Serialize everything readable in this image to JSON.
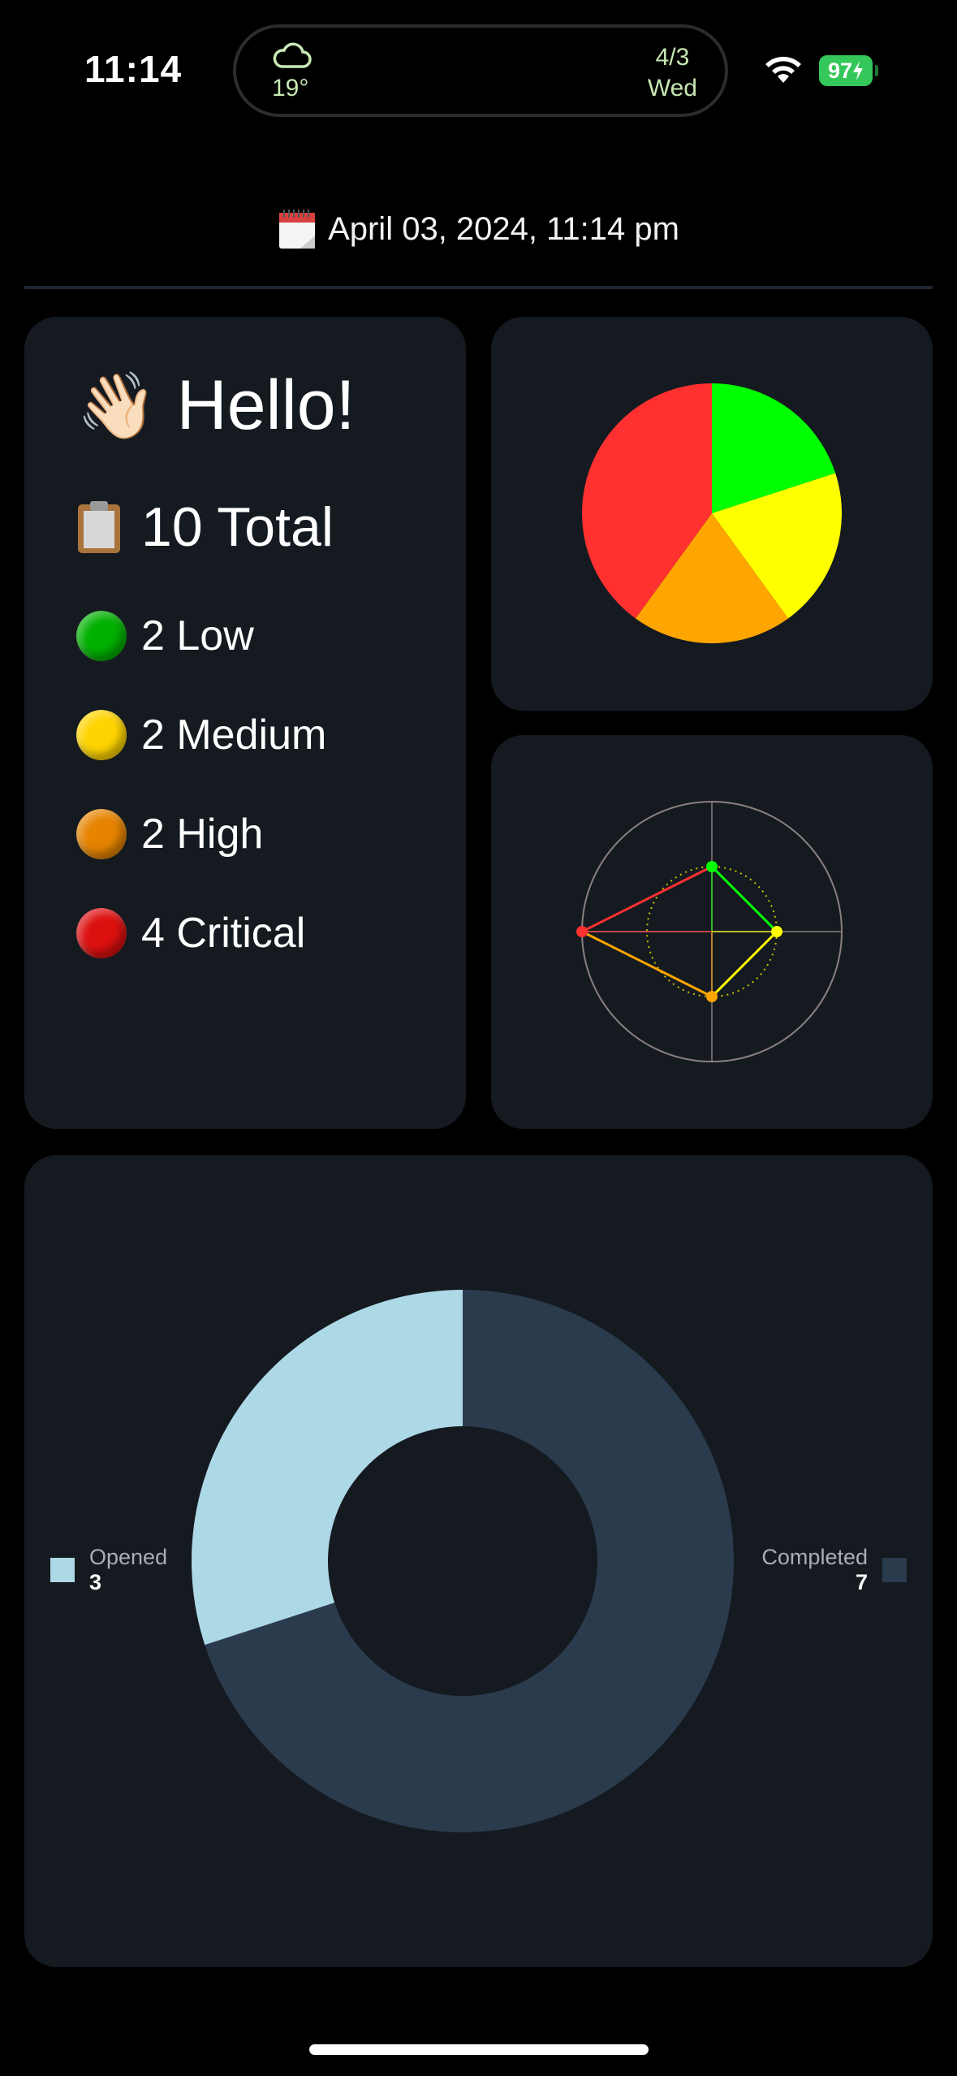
{
  "status_bar": {
    "time": "11:14",
    "weather_temp": "19°",
    "island_date": "4/3",
    "island_day": "Wed",
    "weather_icon": "cloud-icon",
    "battery": "97"
  },
  "header": {
    "date_text": "April 03, 2024, 11:14 pm",
    "icon": "calendar-icon"
  },
  "summary": {
    "greeting": "Hello!",
    "greeting_icon": "waving-hand-icon",
    "total_text": "10 Total",
    "total_icon": "clipboard-icon",
    "items": [
      {
        "label": "2 Low",
        "count": 2,
        "color": "#00c000"
      },
      {
        "label": "2 Medium",
        "count": 2,
        "color": "#ffd800"
      },
      {
        "label": "2 High",
        "count": 2,
        "color": "#f08800"
      },
      {
        "label": "4 Critical",
        "count": 4,
        "color": "#e01010"
      }
    ]
  },
  "chart_data": [
    {
      "type": "pie",
      "categories": [
        "Low",
        "Medium",
        "High",
        "Critical"
      ],
      "values": [
        2,
        2,
        2,
        4
      ],
      "colors": [
        "#00ff00",
        "#ffff00",
        "#ffa500",
        "#ff3030"
      ]
    },
    {
      "type": "radar",
      "categories": [
        "Low",
        "Medium",
        "High",
        "Critical"
      ],
      "values": [
        2,
        2,
        2,
        4
      ],
      "max": 4,
      "colors": [
        "#00ff00",
        "#ffff00",
        "#ffa500",
        "#ff3030"
      ]
    },
    {
      "type": "pie",
      "style": "donut",
      "categories": [
        "Opened",
        "Completed"
      ],
      "values": [
        3,
        7
      ],
      "labels": {
        "Opened": "3",
        "Completed": "7"
      },
      "colors": [
        "#add8e6",
        "#2b3b4e"
      ]
    }
  ]
}
